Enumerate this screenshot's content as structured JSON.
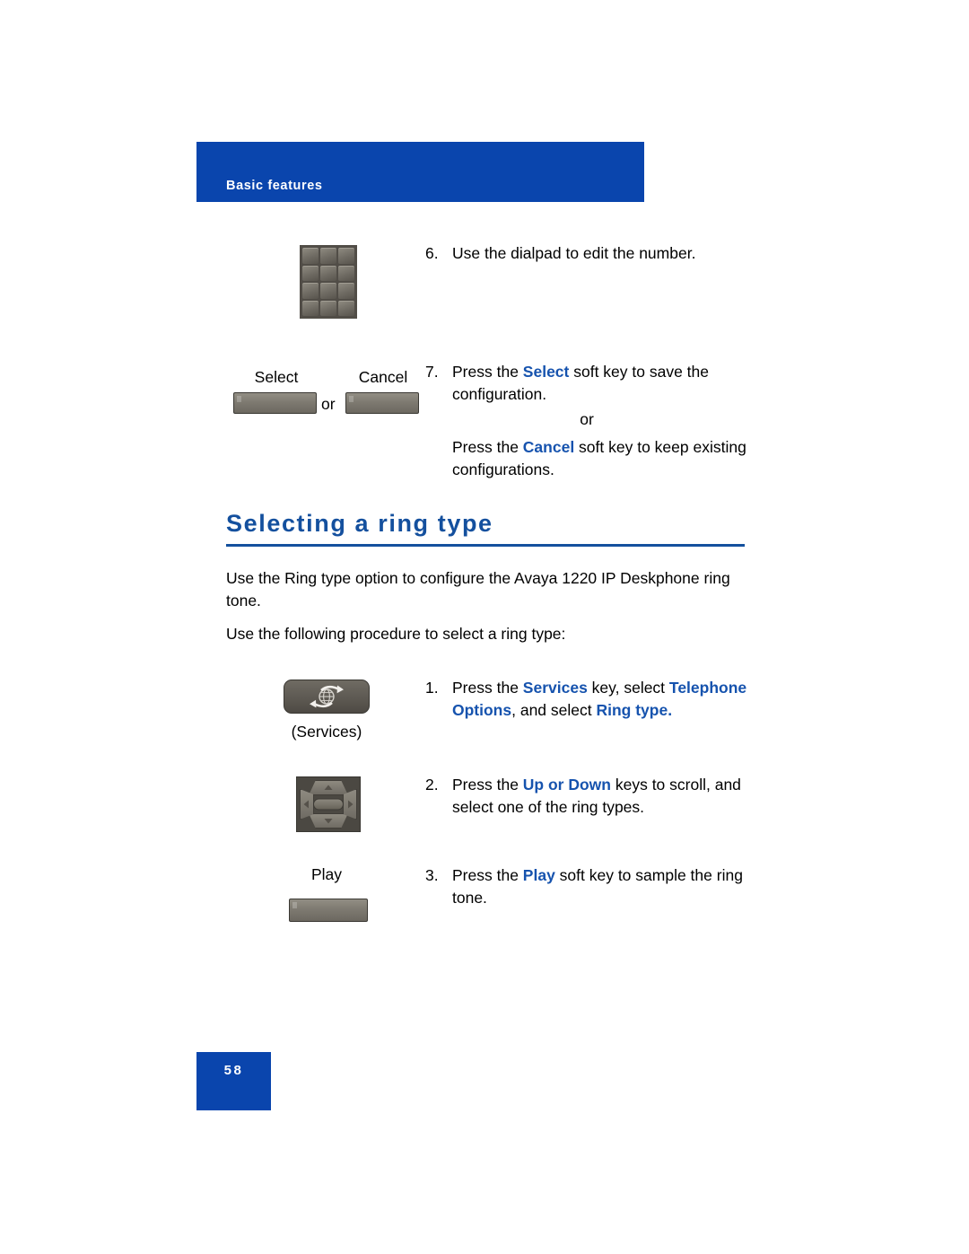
{
  "header": {
    "banner_label": "Basic features",
    "banner_color": "#0a45ad"
  },
  "heading": {
    "title": "Selecting a ring type",
    "color": "#14509e"
  },
  "paragraphs": {
    "intro_1": "Use the Ring type option to configure the Avaya 1220 IP Deskphone ring tone.",
    "intro_2": "Use the following procedure to select a ring type:"
  },
  "steps_top": {
    "step6": {
      "number": "6.",
      "text": "Use the dialpad to edit the number."
    },
    "step7": {
      "number": "7.",
      "line1_pre": "Press the ",
      "line1_kw": "Select",
      "line1_post": " soft key to save the configuration.",
      "or": "or",
      "line2_pre": "Press the ",
      "line2_kw": "Cancel",
      "line2_post": " soft key to keep existing configurations."
    }
  },
  "steps_bottom": {
    "step1": {
      "number": "1.",
      "seg1": "Press the ",
      "kw1": "Services",
      "seg2": " key, select ",
      "kw2": "Telephone Options",
      "seg3": ", and select ",
      "kw3": "Ring type."
    },
    "step2": {
      "number": "2.",
      "seg1": "Press the ",
      "kw1": "Up or Down",
      "seg2": " keys to scroll, and select one of the ring types."
    },
    "step3": {
      "number": "3.",
      "seg1": "Press the ",
      "kw1": "Play",
      "seg2": " soft key to sample the ring tone."
    }
  },
  "key_labels": {
    "select": "Select",
    "cancel": "Cancel",
    "or": "or",
    "services": "(Services)",
    "play": "Play"
  },
  "footer": {
    "page_number": "58"
  },
  "colors": {
    "banner_blue": "#0a45ad",
    "heading_blue": "#14509e",
    "keyword_blue": "#1653ae",
    "key_gray": "#7e7a71"
  }
}
